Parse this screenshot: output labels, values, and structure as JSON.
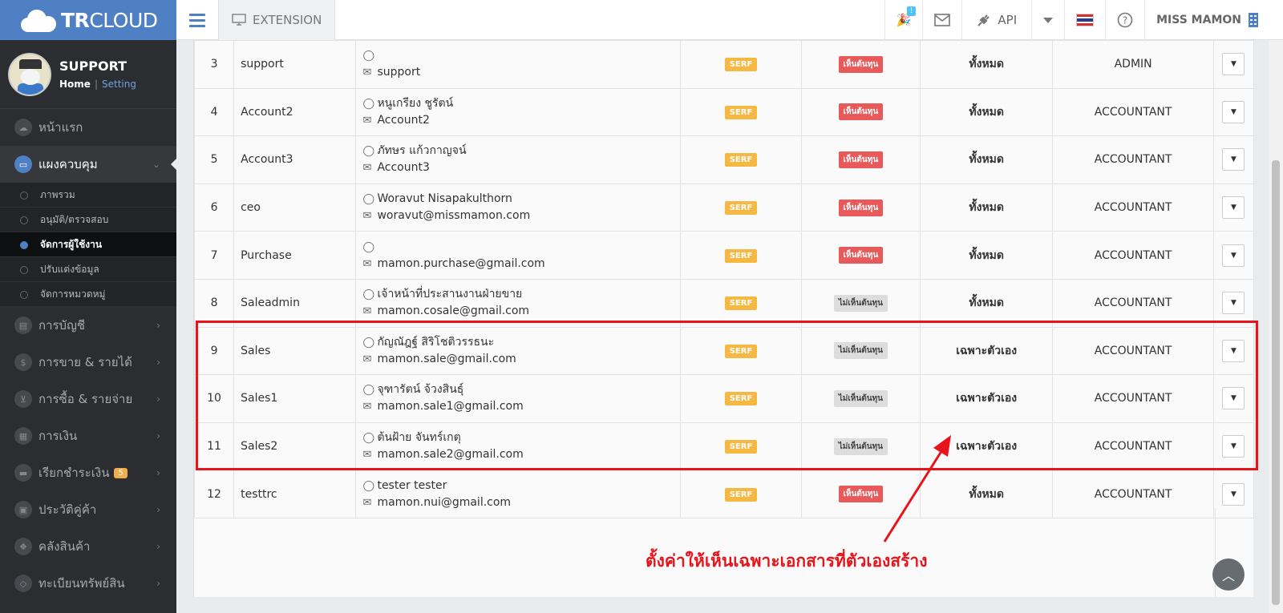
{
  "header": {
    "logo_bold": "TR",
    "logo_light": "CLOUD",
    "extension_label": "EXTENSION",
    "api_label": "API",
    "notification_badge": "!",
    "user_name": "MISS MAMON"
  },
  "profile": {
    "name": "SUPPORT",
    "home": "Home",
    "setting": "Setting"
  },
  "sidebar": {
    "items": [
      {
        "label": "หน้าแรก",
        "icon": "cloud-icon",
        "active": false
      },
      {
        "label": "แผงควบคุม",
        "icon": "monitor-icon",
        "active": true
      }
    ],
    "subitems": [
      {
        "label": "ภาพรวม",
        "active": false
      },
      {
        "label": "อนุมัติ/ตรวจสอบ",
        "active": false
      },
      {
        "label": "จัดการผู้ใช้งาน",
        "active": true
      },
      {
        "label": "ปรับแต่งข้อมูล",
        "active": false
      },
      {
        "label": "จัดการหมวดหมู่",
        "active": false
      }
    ],
    "items_after": [
      {
        "label": "การบัญชี",
        "icon": "book-icon"
      },
      {
        "label": "การขาย & รายได้",
        "icon": "dollar-icon"
      },
      {
        "label": "การซื้อ & รายจ่าย",
        "icon": "cart-icon"
      },
      {
        "label": "การเงิน",
        "icon": "calendar-icon"
      },
      {
        "label": "เรียกชำระเงิน",
        "icon": "card-icon",
        "badge": "5"
      },
      {
        "label": "ประวัติคู่ค้า",
        "icon": "contact-icon"
      },
      {
        "label": "คลังสินค้า",
        "icon": "boxes-icon"
      },
      {
        "label": "ทะเบียนทรัพย์สิน",
        "icon": "diamond-icon"
      }
    ]
  },
  "users": [
    {
      "id": "3",
      "username": "support",
      "fullname": "",
      "email": "support",
      "serf": "SERF",
      "cost": "เห็นต้นทุน",
      "cost_type": "red",
      "scope": "ทั้งหมด",
      "scope_type": "all",
      "role": "ADMIN"
    },
    {
      "id": "4",
      "username": "Account2",
      "fullname": "หนูเกรียง ชูรัตน์",
      "email": "Account2",
      "serf": "SERF",
      "cost": "เห็นต้นทุน",
      "cost_type": "red",
      "scope": "ทั้งหมด",
      "scope_type": "all",
      "role": "ACCOUNTANT"
    },
    {
      "id": "5",
      "username": "Account3",
      "fullname": "ภัทษร แก้วกาญจน์",
      "email": "Account3",
      "serf": "SERF",
      "cost": "เห็นต้นทุน",
      "cost_type": "red",
      "scope": "ทั้งหมด",
      "scope_type": "all",
      "role": "ACCOUNTANT"
    },
    {
      "id": "6",
      "username": "ceo",
      "fullname": "Woravut Nisapakulthorn",
      "email": "woravut@missmamon.com",
      "serf": "SERF",
      "cost": "เห็นต้นทุน",
      "cost_type": "red",
      "scope": "ทั้งหมด",
      "scope_type": "all",
      "role": "ACCOUNTANT"
    },
    {
      "id": "7",
      "username": "Purchase",
      "fullname": "",
      "email": "mamon.purchase@gmail.com",
      "serf": "SERF",
      "cost": "เห็นต้นทุน",
      "cost_type": "red",
      "scope": "ทั้งหมด",
      "scope_type": "all",
      "role": "ACCOUNTANT"
    },
    {
      "id": "8",
      "username": "Saleadmin",
      "fullname": "เจ้าหน้าที่ประสานงานฝ่ายขาย",
      "email": "mamon.cosale@gmail.com",
      "serf": "SERF",
      "cost": "ไม่เห็นต้นทุน",
      "cost_type": "gray",
      "scope": "ทั้งหมด",
      "scope_type": "all",
      "role": "ACCOUNTANT"
    },
    {
      "id": "9",
      "username": "Sales",
      "fullname": "กัญณัฎฐ์ สิริโชติวรรธนะ",
      "email": "mamon.sale@gmail.com",
      "serf": "SERF",
      "cost": "ไม่เห็นต้นทุน",
      "cost_type": "gray",
      "scope": "เฉพาะตัวเอง",
      "scope_type": "own",
      "role": "ACCOUNTANT"
    },
    {
      "id": "10",
      "username": "Sales1",
      "fullname": "จุฑารัตน์ จ้วงสินธุ์",
      "email": "mamon.sale1@gmail.com",
      "serf": "SERF",
      "cost": "ไม่เห็นต้นทุน",
      "cost_type": "gray",
      "scope": "เฉพาะตัวเอง",
      "scope_type": "own",
      "role": "ACCOUNTANT"
    },
    {
      "id": "11",
      "username": "Sales2",
      "fullname": "ต้นฝ้าย จันทร์เกตุ",
      "email": "mamon.sale2@gmail.com",
      "serf": "SERF",
      "cost": "ไม่เห็นต้นทุน",
      "cost_type": "gray",
      "scope": "เฉพาะตัวเอง",
      "scope_type": "own",
      "role": "ACCOUNTANT"
    },
    {
      "id": "12",
      "username": "testtrc",
      "fullname": "tester tester",
      "email": "mamon.nui@gmail.com",
      "serf": "SERF",
      "cost": "เห็นต้นทุน",
      "cost_type": "red",
      "scope": "ทั้งหมด",
      "scope_type": "all",
      "role": "ACCOUNTANT"
    }
  ],
  "annotation": {
    "text": "ตั้งค่าให้เห็นเฉพาะเอกสารที่ตัวเองสร้าง",
    "color": "#e8141c"
  },
  "colors": {
    "brand": "#4f80c4",
    "sidebar_bg": "#2b2d30",
    "scope_all": "#e85a5a",
    "scope_own": "#2fae7e",
    "serf_badge": "#f5b842"
  }
}
